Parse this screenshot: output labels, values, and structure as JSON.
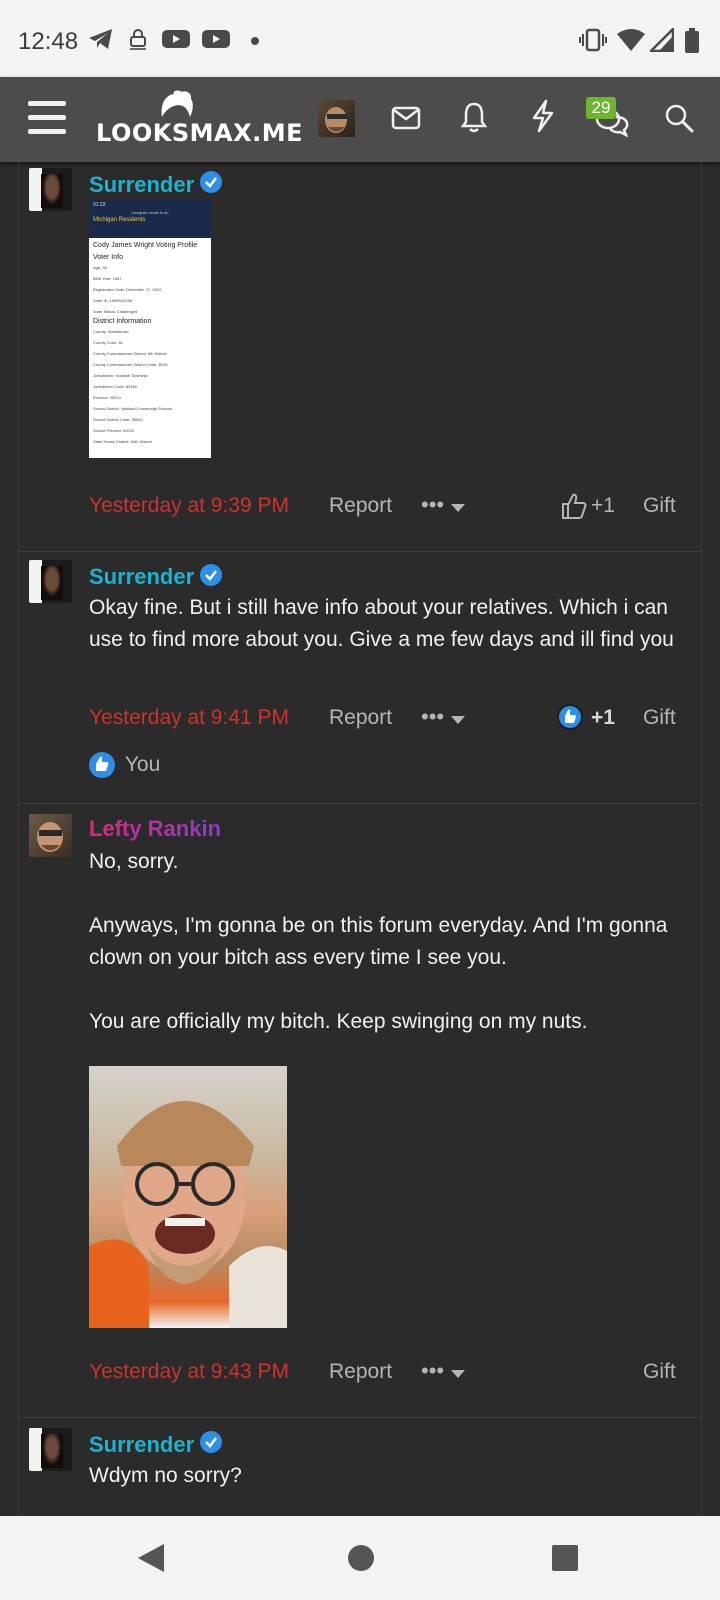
{
  "status_bar": {
    "time": "12:48",
    "icons": [
      "telegram-icon",
      "shield-icon",
      "youtube-icon",
      "youtube-icon",
      "dot-icon",
      "vibrate-icon",
      "wifi-icon",
      "signal-icon",
      "battery-icon"
    ]
  },
  "header": {
    "logo_text": "LOOKSMAX.ME",
    "conversations_badge": "29",
    "icons": [
      "menu-icon",
      "avatar",
      "mail-icon",
      "bell-icon",
      "bolt-icon",
      "chat-icon",
      "search-icon"
    ]
  },
  "posts": [
    {
      "username": "Surrender",
      "verified": true,
      "attachment": {
        "kind": "screenshot",
        "status_time": "01:22",
        "banner": "Incognito mode is on",
        "site": "Michigan Residents",
        "title": "Cody James Wright Voting Profile",
        "section1": "Voter Info",
        "rows1": [
          "Age: 36",
          "Birth Year: 1987",
          "Registration Date: December 27, 2010",
          "Voter ID: 1065016258",
          "Voter Status: Challenged"
        ],
        "section2": "District Information",
        "rows2": [
          "County: Washtenaw",
          "County Code: 81",
          "County Commissioner District: 6th District",
          "County Commissioner District Code: 8105",
          "Jurisdiction: Ypsilanti Township",
          "Jurisdiction Code: 89160",
          "Precinct: 00010",
          "School District: Ypsilanti Community Schools",
          "School District Code: 38920",
          "School Precinct: 00010",
          "State House District: 54th District"
        ]
      },
      "date": "Yesterday at 9:39 PM",
      "report": "Report",
      "more": "•••",
      "like_count": "+1",
      "gift": "Gift"
    },
    {
      "username": "Surrender",
      "verified": true,
      "message": "Okay fine. But i still have info about your relatives. Which i can use to find more about you. Give a me few days and ill find you",
      "date": "Yesterday at 9:41 PM",
      "report": "Report",
      "more": "•••",
      "like_count": "+1",
      "gift": "Gift",
      "reaction_by": "You"
    },
    {
      "username": "Lefty Rankin",
      "verified": false,
      "message_lines": [
        "No, sorry.",
        "Anyways, I'm gonna be on this forum everyday. And I'm gonna clown on your bitch ass every time I see you.",
        "You are officially my bitch. Keep swinging on my nuts."
      ],
      "date": "Yesterday at 9:43 PM",
      "report": "Report",
      "more": "•••",
      "gift": "Gift"
    },
    {
      "username": "Surrender",
      "verified": true,
      "message": "Wdym no sorry?"
    }
  ],
  "colors": {
    "accent": "#19b4d2",
    "date_red": "#d0322a",
    "badge_green": "#6eb52e",
    "verified_blue": "#2e8fe8"
  }
}
